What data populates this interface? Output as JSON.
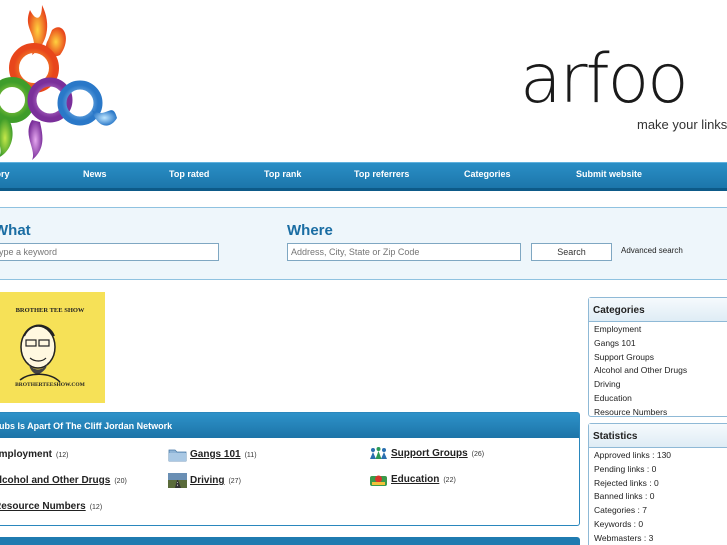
{
  "brand": {
    "name": "arfoo",
    "tagline": "make your links"
  },
  "nav": {
    "items": [
      {
        "label": "Directory"
      },
      {
        "label": "News"
      },
      {
        "label": "Top rated"
      },
      {
        "label": "Top rank"
      },
      {
        "label": "Top referrers"
      },
      {
        "label": "Categories"
      },
      {
        "label": "Submit website"
      }
    ]
  },
  "search": {
    "what_label": "What",
    "what_placeholder": "Type a keyword",
    "where_label": "Where",
    "where_placeholder": "Address, City, State or Zip Code",
    "button_label": "Search",
    "advanced_label": "Advanced search"
  },
  "banner": {
    "top_text": "BROTHER TEE SHOW",
    "bottom_text": "BROTHERTEESHOW.COM"
  },
  "main": {
    "heading": "Clubs Is Apart Of The Cliff Jordan Network",
    "categories": [
      {
        "label": "Employment",
        "count": "(12)",
        "icon": "none"
      },
      {
        "label": "Gangs 101",
        "count": "(11)",
        "icon": "folder-icon"
      },
      {
        "label": "Support Groups",
        "count": "(26)",
        "icon": "group-icon"
      },
      {
        "label": "Alcohol and Other Drugs",
        "count": "(20)",
        "icon": "none"
      },
      {
        "label": "Driving",
        "count": "(27)",
        "icon": "road-icon"
      },
      {
        "label": "Education",
        "count": "(22)",
        "icon": "education-icon"
      },
      {
        "label": "Resource Numbers",
        "count": "(12)",
        "icon": "none"
      }
    ]
  },
  "sidebar": {
    "categories_title": "Categories",
    "categories": [
      "Employment",
      "Gangs 101",
      "Support Groups",
      "Alcohol and Other Drugs",
      "Driving",
      "Education",
      "Resource Numbers"
    ],
    "statistics_title": "Statistics",
    "statistics": [
      "Approved links : 130",
      "Pending links : 0",
      "Rejected links : 0",
      "Banned links : 0",
      "Categories : 7",
      "Keywords : 0",
      "Webmasters : 3"
    ]
  },
  "colors": {
    "nav_blue": "#1f80b8",
    "heading_blue": "#1a6da3",
    "panel_bg": "#eef6fb"
  }
}
